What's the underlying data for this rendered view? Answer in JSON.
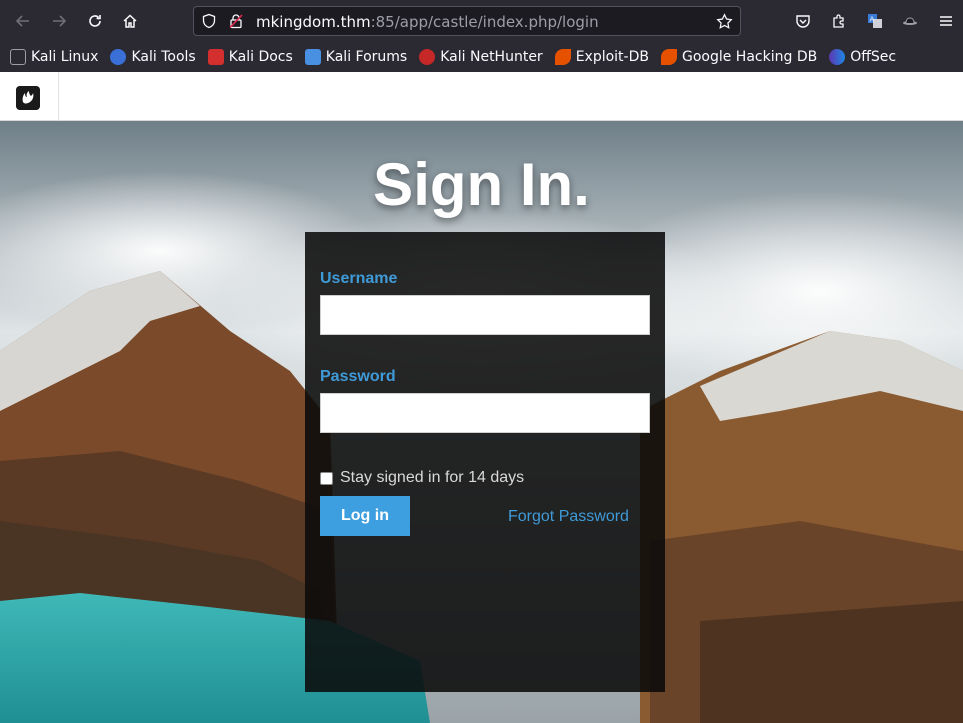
{
  "browser": {
    "url_host": "mkingdom.thm",
    "url_rest": ":85/app/castle/index.php/login",
    "bookmarks": [
      {
        "label": "Kali Linux",
        "icon": "kali-dragon-icon"
      },
      {
        "label": "Kali Tools",
        "icon": "kali-tools-icon"
      },
      {
        "label": "Kali Docs",
        "icon": "kali-docs-icon"
      },
      {
        "label": "Kali Forums",
        "icon": "kali-forums-icon"
      },
      {
        "label": "Kali NetHunter",
        "icon": "nethunter-icon"
      },
      {
        "label": "Exploit-DB",
        "icon": "exploit-db-icon"
      },
      {
        "label": "Google Hacking DB",
        "icon": "ghdb-icon"
      },
      {
        "label": "OffSec",
        "icon": "offsec-icon"
      }
    ]
  },
  "page": {
    "title": "Sign In.",
    "form": {
      "username_label": "Username",
      "username_value": "",
      "password_label": "Password",
      "password_value": "",
      "remember_label": "Stay signed in for 14 days",
      "remember_checked": false,
      "login_label": "Log in",
      "forgot_label": "Forgot Password"
    }
  },
  "colors": {
    "accent": "#3f9ad8",
    "button": "#3d9ee0",
    "panel": "#0a0a0a",
    "toolbar": "#2b2a33"
  }
}
